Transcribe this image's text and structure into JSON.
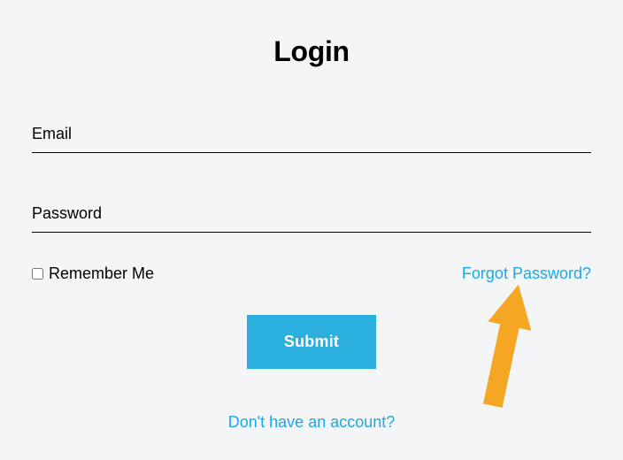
{
  "title": "Login",
  "fields": {
    "email": {
      "placeholder": "Email",
      "value": ""
    },
    "password": {
      "placeholder": "Password",
      "value": ""
    }
  },
  "remember": {
    "label": "Remember Me",
    "checked": false
  },
  "links": {
    "forgot": "Forgot Password?",
    "signup": "Don't have an account?"
  },
  "submit_label": "Submit",
  "colors": {
    "accent": "#2aafdf",
    "link": "#1ca8e3",
    "arrow": "#f5a623",
    "background": "#f4f5f7"
  }
}
